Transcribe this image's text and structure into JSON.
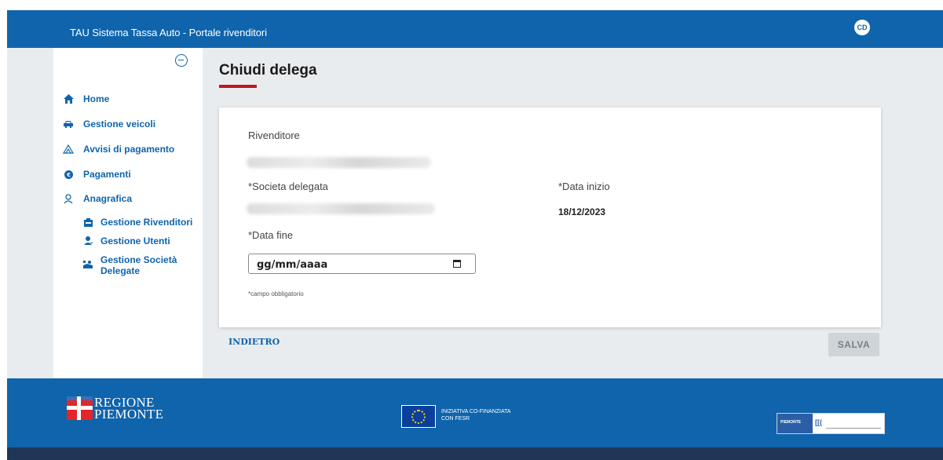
{
  "app": {
    "title": "TAU Sistema Tassa Auto - Portale rivenditori",
    "user_initials": "CD"
  },
  "sidebar": {
    "items": [
      {
        "label": "Home",
        "icon": "home-icon"
      },
      {
        "label": "Gestione veicoli",
        "icon": "car-icon"
      },
      {
        "label": "Avvisi di pagamento",
        "icon": "document-icon"
      },
      {
        "label": "Pagamenti",
        "icon": "euro-icon"
      },
      {
        "label": "Anagrafica",
        "icon": "user-icon"
      }
    ],
    "sub_items": [
      {
        "label": "Gestione Rivenditori",
        "icon": "store-icon"
      },
      {
        "label": "Gestione Utenti",
        "icon": "user-add-icon"
      },
      {
        "label_line1": "Gestione Società",
        "label_line2": "Delegate",
        "icon": "handshake-icon"
      }
    ]
  },
  "page": {
    "title": "Chiudi delega"
  },
  "form": {
    "rivenditore_label": "Rivenditore",
    "societa_label": "*Societa delegata",
    "data_inizio_label": "*Data inizio",
    "data_inizio_value": "18/12/2023",
    "data_fine_label": "*Data fine",
    "data_fine_placeholder": "gg/mm/aaaa",
    "required_note": "*campo obbligatorio"
  },
  "actions": {
    "back_label": "INDIETRO",
    "save_label": "SALVA"
  },
  "footer": {
    "regione_line1": "REGIONE",
    "regione_line2": "PIEMONTE",
    "eu_line1": "INIZIATIVA CO-FINANZIATA",
    "eu_line2": "CON FESR"
  },
  "colors": {
    "primary": "#0f64ac",
    "accent": "#c0161c",
    "footer_dark": "#1f3656"
  }
}
